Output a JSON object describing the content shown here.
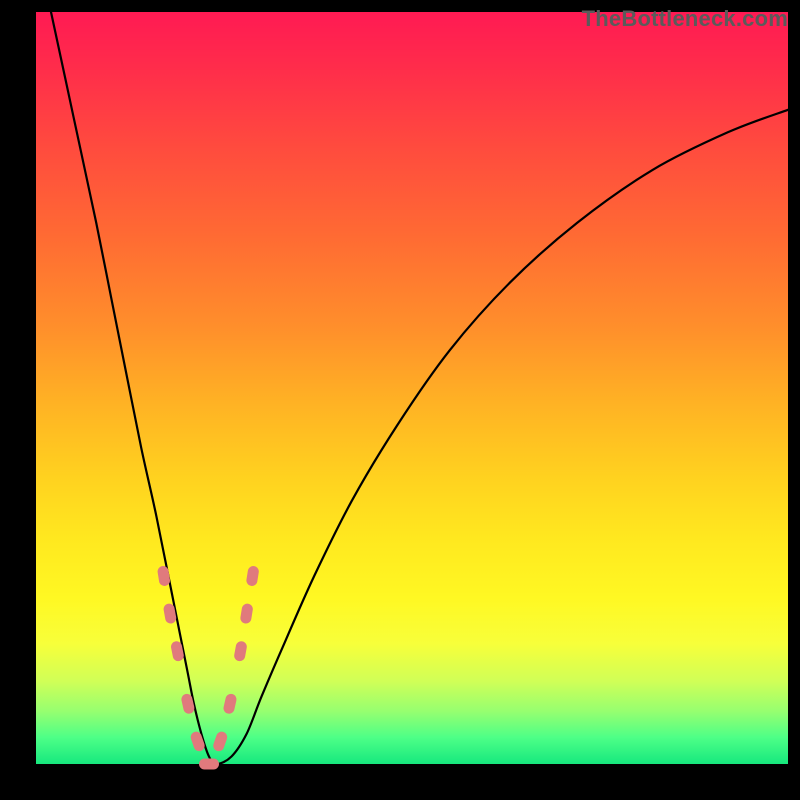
{
  "attribution": "TheBottleneck.com",
  "colors": {
    "frame": "#000000",
    "curve": "#000000",
    "marker": "#e07a7d",
    "gradient_top": "#ff1a53",
    "gradient_bottom": "#17e87e"
  },
  "chart_data": {
    "type": "line",
    "title": "",
    "xlabel": "",
    "ylabel": "",
    "xlim": [
      0,
      100
    ],
    "ylim": [
      0,
      100
    ],
    "grid": false,
    "legend": false,
    "note": "Axes unlabeled in source image; x interpreted as relative component strength (0–100), y as bottleneck severity (0 = none, 100 = max). Values estimated from pixel positions.",
    "series": [
      {
        "name": "bottleneck-curve",
        "x": [
          2,
          5,
          8,
          10,
          12,
          14,
          16,
          18,
          20,
          21,
          22,
          23,
          24,
          26,
          28,
          30,
          33,
          37,
          42,
          48,
          55,
          63,
          72,
          82,
          92,
          100
        ],
        "y": [
          100,
          86,
          72,
          62,
          52,
          42,
          33,
          23,
          13,
          8,
          4,
          1,
          0,
          1,
          4,
          9,
          16,
          25,
          35,
          45,
          55,
          64,
          72,
          79,
          84,
          87
        ]
      }
    ],
    "markers": {
      "name": "highlight-points",
      "shape": "rounded-capsule",
      "x": [
        17.0,
        17.8,
        18.8,
        20.2,
        21.5,
        23.0,
        24.5,
        25.8,
        27.2,
        28.0,
        28.8
      ],
      "y": [
        25,
        20,
        15,
        8,
        3,
        0,
        3,
        8,
        15,
        20,
        25
      ]
    }
  }
}
